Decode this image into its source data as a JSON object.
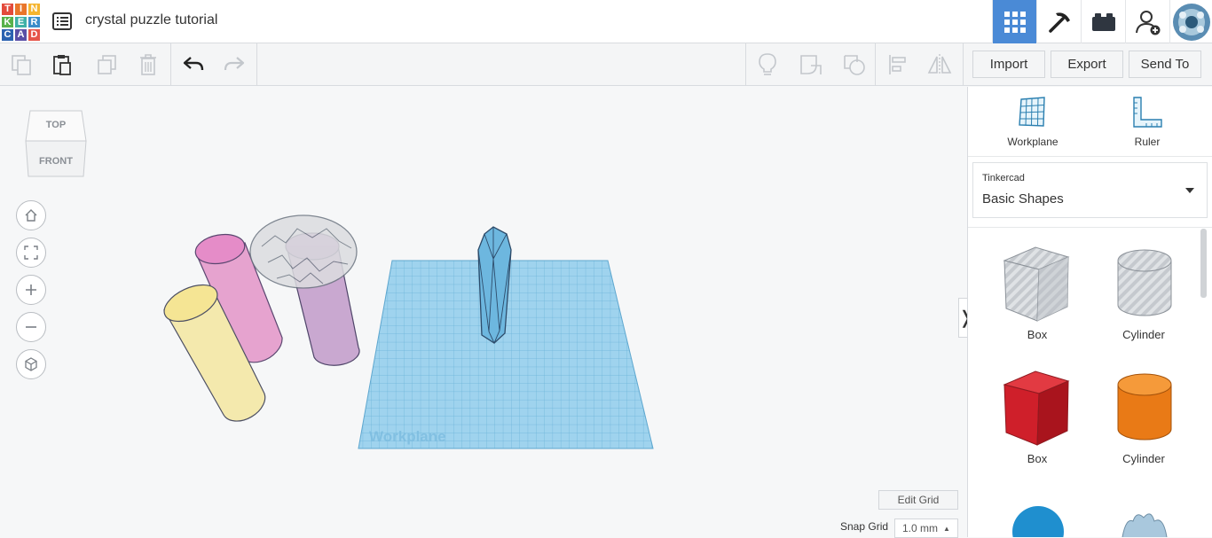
{
  "logo": {
    "letters": [
      "T",
      "I",
      "N",
      "K",
      "E",
      "R",
      "C",
      "A",
      "D"
    ],
    "colors": [
      "#e34b3c",
      "#e9762b",
      "#f5b52f",
      "#58b14b",
      "#3fb1a7",
      "#3b8dc9",
      "#2b62b0",
      "#5b4fa6",
      "#e6554a"
    ]
  },
  "header": {
    "title": "crystal puzzle tutorial",
    "menu_icon": "list-icon"
  },
  "header_right": {
    "icons": [
      "grid-view-icon",
      "pickaxe-icon",
      "bricks-icon",
      "add-user-icon",
      "avatar"
    ]
  },
  "toolbar": {
    "import_label": "Import",
    "export_label": "Export",
    "send_to_label": "Send To"
  },
  "view_cube": {
    "top": "TOP",
    "front": "FRONT"
  },
  "workplane_label": "Workplane",
  "bottom": {
    "edit_grid_label": "Edit Grid",
    "snap_grid_label": "Snap Grid",
    "snap_grid_value": "1.0 mm"
  },
  "panel": {
    "tools": [
      {
        "label": "Workplane",
        "icon": "workplane-icon"
      },
      {
        "label": "Ruler",
        "icon": "ruler-icon"
      }
    ],
    "library": {
      "provider": "Tinkercad",
      "selected": "Basic Shapes"
    },
    "shapes": [
      {
        "label": "Box",
        "color": "#aab0b8",
        "style": "hole"
      },
      {
        "label": "Cylinder",
        "color": "#aab0b8",
        "style": "hole"
      },
      {
        "label": "Box",
        "color": "#d3212c",
        "style": "solid"
      },
      {
        "label": "Cylinder",
        "color": "#f0841f",
        "style": "solid"
      }
    ]
  },
  "colors": {
    "accent": "#4a8ad6",
    "workplane": "#8fcbe9",
    "crystal": "#5aa8d3"
  }
}
